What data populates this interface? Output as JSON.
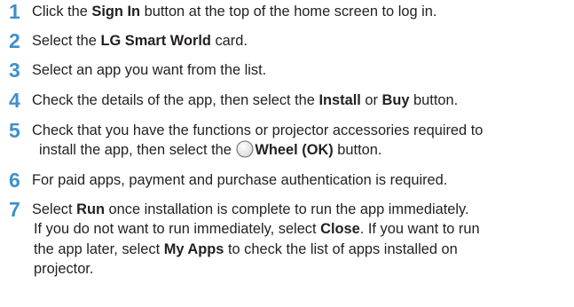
{
  "steps": [
    {
      "number": "1",
      "pre": "Click the ",
      "b1": "Sign In",
      "post": " button at the top of the home screen to log in."
    },
    {
      "number": "2",
      "pre": "Select the ",
      "b1": "LG Smart World",
      "post": " card."
    },
    {
      "number": "3",
      "text": "Select an app you want from the list."
    },
    {
      "number": "4",
      "pre": "Check the details of the app, then select the ",
      "b1": "Install",
      "mid": " or ",
      "b2": "Buy",
      "post": " button."
    },
    {
      "number": "5",
      "line1": "Check that you have the functions or projector accessories required to",
      "pre": "install the app, then select the ",
      "icon": "wheel-button-icon",
      "b1": "Wheel (OK)",
      "post": " button."
    },
    {
      "number": "6",
      "text": "For paid apps, payment and purchase authentication is required."
    },
    {
      "number": "7",
      "l1_pre": "Select ",
      "l1_b": "Run",
      "l1_post": " once installation is complete to run the app immediately.",
      "l2_pre": "If you do not want to run immediately, select ",
      "l2_b": "Close",
      "l2_post": ". If you want to run",
      "l3_pre": "the app later, select ",
      "l3_b": "My Apps",
      "l3_post": " to check the list of apps installed on",
      "l4": "projector."
    }
  ]
}
